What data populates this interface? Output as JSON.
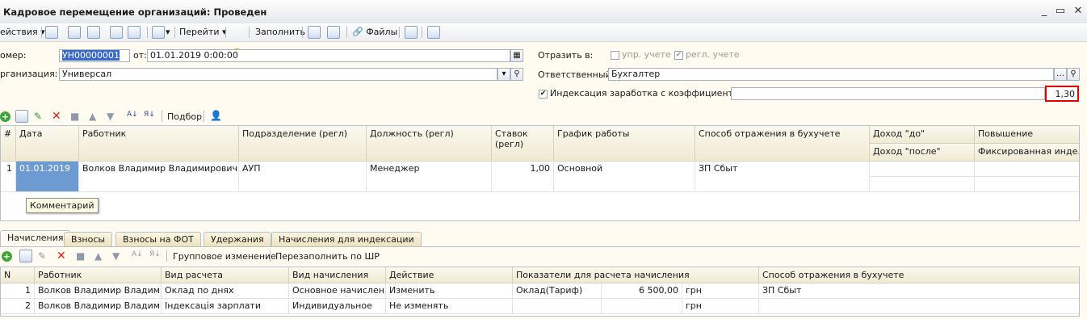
{
  "window": {
    "title": "Кадровое перемещение организаций: Проведен",
    "minimize": "_",
    "restore": "▭",
    "close": "✕"
  },
  "toolbar": {
    "actions_label": "ействия",
    "goto_label": "Перейти",
    "fill_label": "Заполнить",
    "files_label": "Файлы",
    "help_icon": "?"
  },
  "form": {
    "number_label": "омер:",
    "number_value": "УН00000001",
    "from_label": "от:",
    "date_value": "01.01.2019  0:00:00",
    "org_label": "рганизация:",
    "org_value": "Универсал",
    "reflect_label": "Отразить в:",
    "mgmt_label": "упр. учете",
    "reg_label": "регл. учете",
    "responsible_label": "Ответственный:",
    "responsible_value": "Бухгалтер",
    "indexation_label": "Индексация заработка с коэффициентом:",
    "indexation_value": "1,30"
  },
  "grid_toolbar": {
    "select_label": "Подбор"
  },
  "main_table": {
    "headers": {
      "n": "#",
      "date": "Дата",
      "worker": "Работник",
      "dept": "Подразделение (регл)",
      "position": "Должность (регл)",
      "rate": "Ставок",
      "rate2": "(регл)",
      "schedule": "График работы",
      "method": "Способ отражения в бухучете",
      "income_before": "Доход \"до\"",
      "income_after": "Доход \"после\"",
      "raise": "Повышение",
      "fixed": "Фиксированная инде..."
    },
    "row": {
      "n": "1",
      "date": "01.01.2019",
      "worker": "Волков Владимир Владимирович",
      "dept": "АУП",
      "position": "Менеджер",
      "rate": "1,00",
      "schedule": "Основной",
      "method": "ЗП Сбыт"
    },
    "tooltip": "Комментарий"
  },
  "tabs": [
    "Начисления",
    "Взносы",
    "Взносы на ФОТ",
    "Удержания",
    "Начисления для индексации"
  ],
  "sub_toolbar": {
    "group_change": "Групповое изменение",
    "refill": "Перезаполнить по ШР"
  },
  "sub_table": {
    "headers": {
      "n": "N",
      "worker": "Работник",
      "calc_type": "Вид расчета",
      "accrual_type": "Вид начисления",
      "action": "Действие",
      "indicators": "Показатели для расчета начисления",
      "method": "Способ отражения в бухучете"
    },
    "rows": [
      {
        "n": "1",
        "worker": "Волков Владимир Владими...",
        "calc_type": "Оклад по днях",
        "accrual_type": "Основное начислен...",
        "action": "Изменить",
        "indicator": "Оклад(Тариф)",
        "amount": "6 500,00",
        "currency": "грн",
        "method": "ЗП Сбыт"
      },
      {
        "n": "2",
        "worker": "Волков Владимир Владими...",
        "calc_type": "Індексація зарплати",
        "accrual_type": "Индивидуальное",
        "action": "Не изменять",
        "indicator": "",
        "amount": "",
        "currency": "грн",
        "method": ""
      }
    ]
  },
  "colors": {
    "background": "#fffbf0",
    "highlight_border": "#e00000",
    "selected_cell": "#6d9bd1"
  }
}
